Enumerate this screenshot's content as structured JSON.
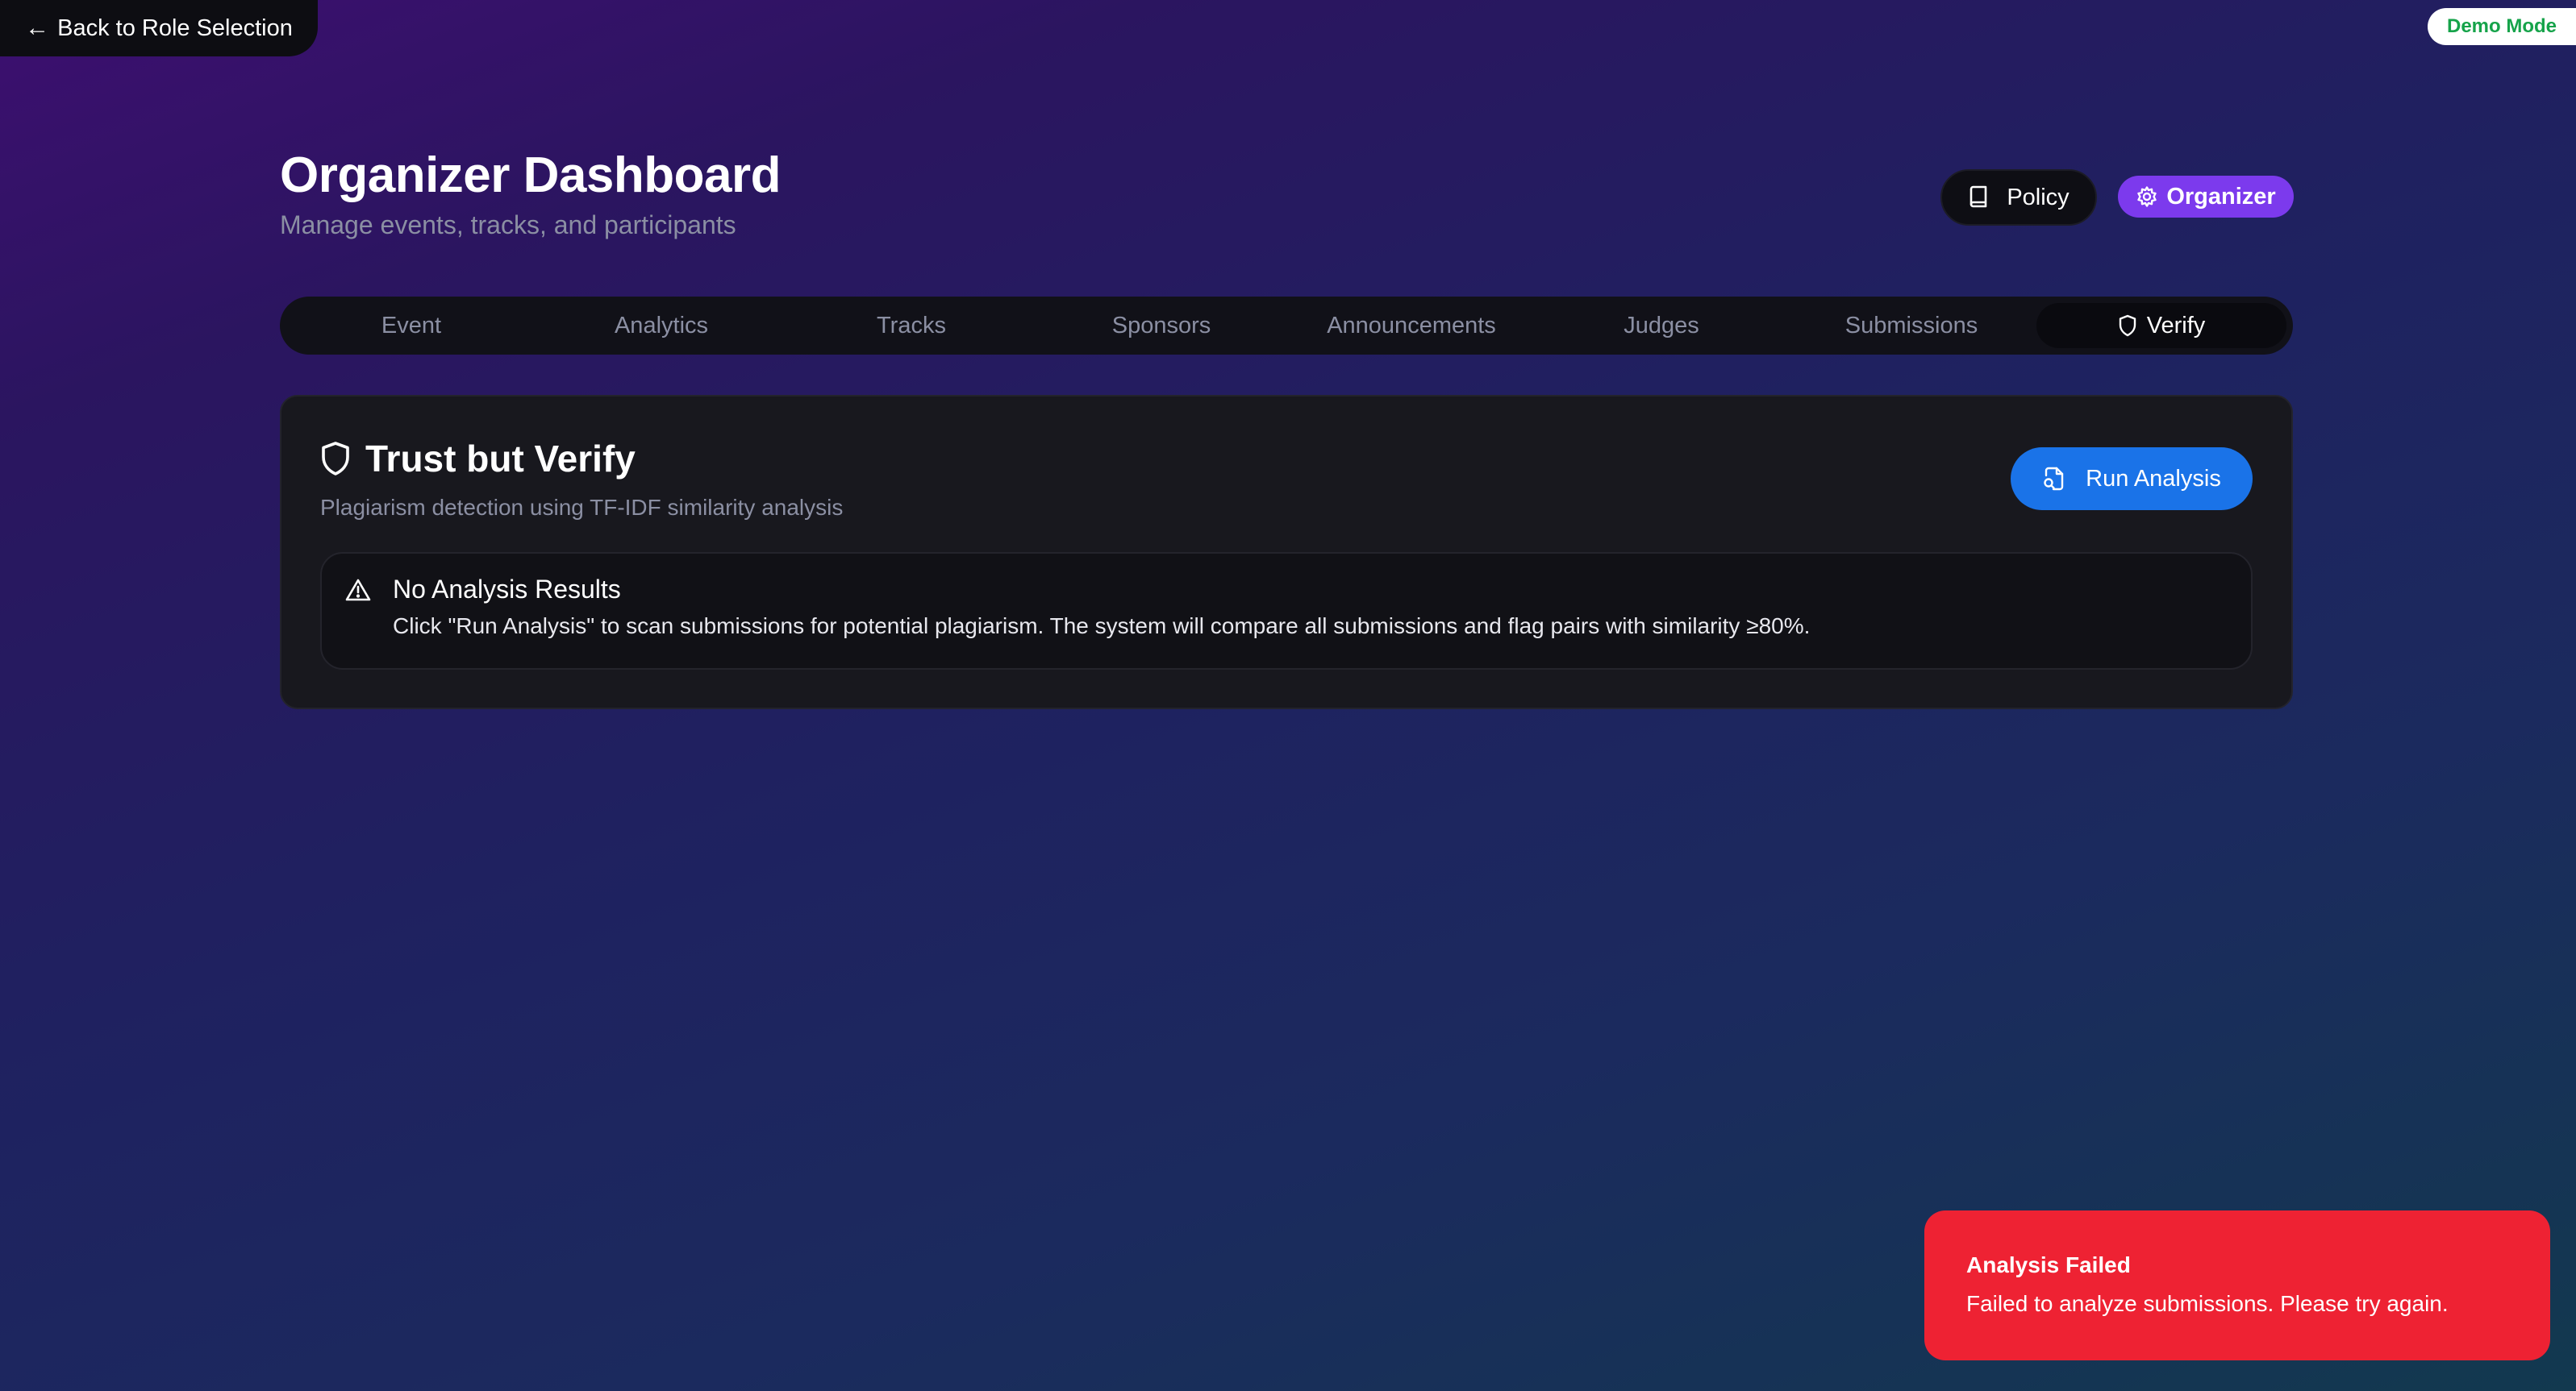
{
  "topbar": {
    "back_arrow": "←",
    "back_label": "Back to Role Selection",
    "demo_badge": "Demo Mode"
  },
  "header": {
    "title": "Organizer Dashboard",
    "subtitle": "Manage events, tracks, and participants",
    "policy_label": "Policy",
    "role_label": "Organizer"
  },
  "tabs": [
    {
      "label": "Event"
    },
    {
      "label": "Analytics"
    },
    {
      "label": "Tracks"
    },
    {
      "label": "Sponsors"
    },
    {
      "label": "Announcements"
    },
    {
      "label": "Judges"
    },
    {
      "label": "Submissions"
    },
    {
      "label": "Verify",
      "active": true,
      "icon": "shield-icon"
    }
  ],
  "verify": {
    "title": "Trust but Verify",
    "description": "Plagiarism detection using TF-IDF similarity analysis",
    "run_label": "Run Analysis",
    "alert_title": "No Analysis Results",
    "alert_body": "Click \"Run Analysis\" to scan submissions for potential plagiarism. The system will compare all submissions and flag pairs with similarity ≥80%."
  },
  "toast": {
    "title": "Analysis Failed",
    "message": "Failed to analyze submissions. Please try again."
  },
  "colors": {
    "accent_purple": "#7c3aed",
    "primary_blue": "#1a73e8",
    "error_red": "#ee2233",
    "demo_green": "#16a34a"
  }
}
